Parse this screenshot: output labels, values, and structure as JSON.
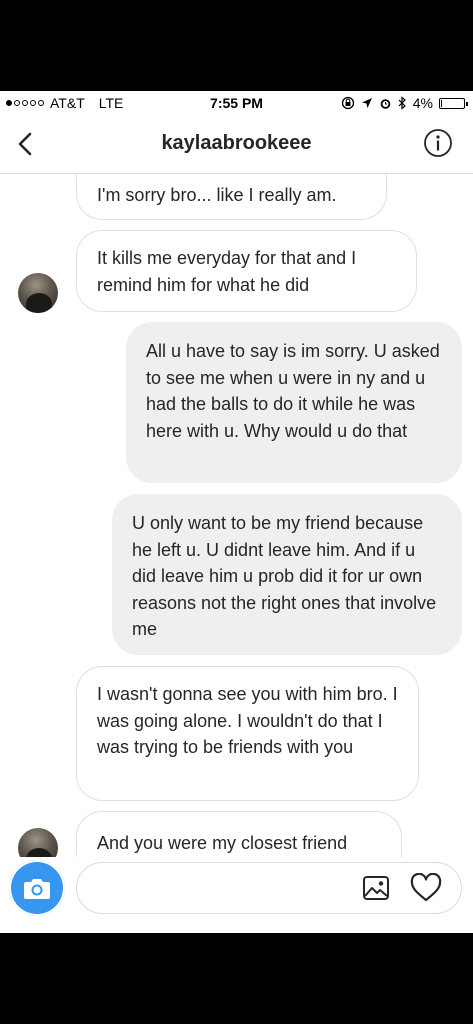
{
  "status_bar": {
    "carrier": "AT&T",
    "network": "LTE",
    "time": "7:55 PM",
    "battery": "4%",
    "battery_level": 0.04,
    "signal_bars": 1,
    "signal_total": 5
  },
  "header": {
    "back_icon": "chevron-left-icon",
    "title": "kaylaabrookeee",
    "info_icon": "info-icon"
  },
  "messages": [
    {
      "direction": "incoming",
      "text": "I'm sorry bro... like I really am."
    },
    {
      "direction": "incoming",
      "text": "It kills me everyday for that and I remind him for what he did"
    },
    {
      "direction": "outgoing",
      "text": "All u have to say is im sorry. U asked to see me when u were in ny and u had the balls to do it while he was here with u. Why would u do that"
    },
    {
      "direction": "outgoing",
      "text": "U only want to be my friend because he left u. U didnt leave him. And if u did leave him u prob did it for ur own reasons not the right ones that involve me"
    },
    {
      "direction": "incoming",
      "text": "I wasn't gonna see you with him bro. I was going alone. I wouldn't do that I was trying to be friends with you"
    },
    {
      "direction": "incoming",
      "text": "And you were my closest friend"
    }
  ],
  "composer": {
    "camera_icon": "camera-icon",
    "input_value": "",
    "gallery_icon": "gallery-icon",
    "heart_icon": "heart-icon"
  },
  "colors": {
    "accent": "#3797f0",
    "outgoing_bubble": "#efefef",
    "incoming_border": "#e0e0e0"
  }
}
